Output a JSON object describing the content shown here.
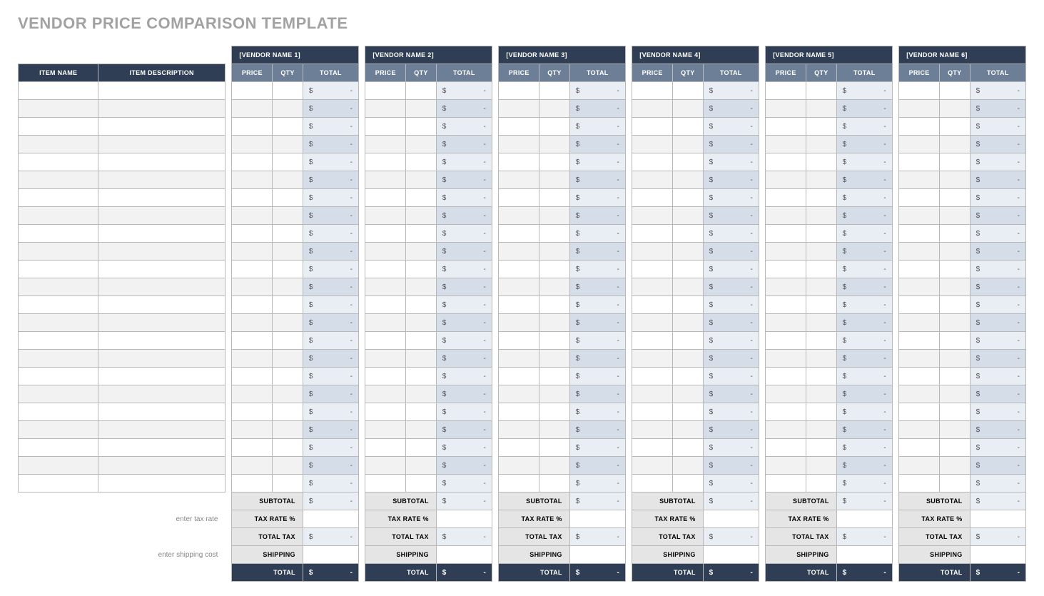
{
  "title": "VENDOR PRICE COMPARISON TEMPLATE",
  "headers": {
    "item_name": "ITEM NAME",
    "item_description": "ITEM DESCRIPTION",
    "price": "PRICE",
    "qty": "QTY",
    "total": "TOTAL"
  },
  "vendors": [
    "[VENDOR NAME 1]",
    "[VENDOR NAME 2]",
    "[VENDOR NAME 3]",
    "[VENDOR NAME 4]",
    "[VENDOR NAME 5]",
    "[VENDOR NAME 6]"
  ],
  "row_count": 23,
  "cell": {
    "symbol": "$",
    "dash": "-"
  },
  "summary": {
    "subtotal": "SUBTOTAL",
    "tax_rate_hint": "enter tax rate",
    "tax_rate": "TAX RATE %",
    "total_tax": "TOTAL TAX",
    "shipping_hint": "enter shipping cost",
    "shipping": "SHIPPING",
    "total": "TOTAL"
  }
}
